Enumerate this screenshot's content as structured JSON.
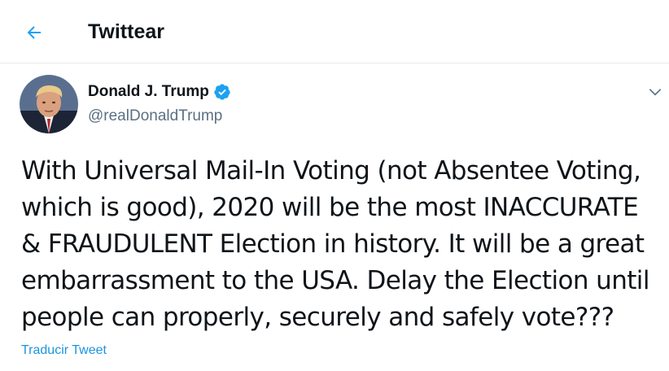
{
  "header": {
    "back_icon": "arrow-left-icon",
    "title": "Twittear"
  },
  "tweet": {
    "author": {
      "name": "Donald J. Trump",
      "handle": "@realDonaldTrump",
      "verified": true,
      "verified_icon": "verified-badge-icon"
    },
    "menu_icon": "chevron-down-icon",
    "text": "With Universal Mail-In Voting (not Absentee Voting, which is good), 2020 will be the most INACCURATE & FRAUDULENT Election in history. It will be a great embarrassment to the USA. Delay the Election until people can properly, securely and safely vote???",
    "translate_label": "Traducir Tweet"
  },
  "colors": {
    "accent": "#1da1f2",
    "link": "#1b95e0",
    "text": "#0f1419",
    "secondary": "#5b7083"
  }
}
